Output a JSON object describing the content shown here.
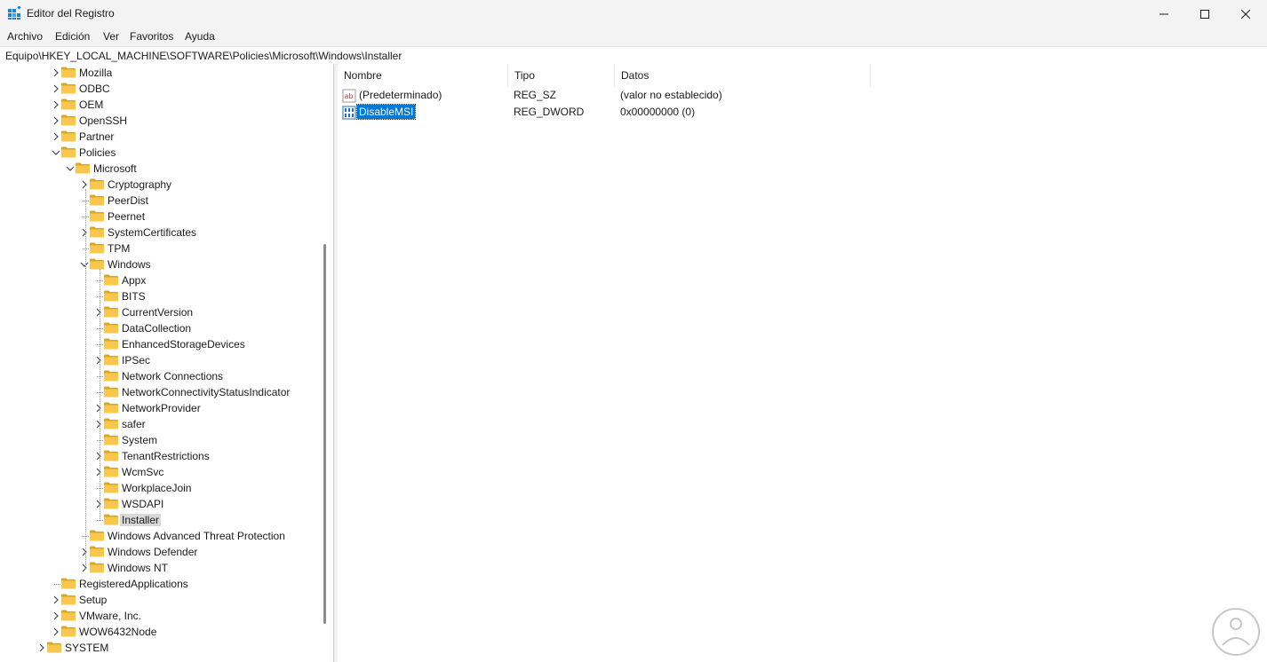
{
  "window": {
    "title": "Editor del Registro"
  },
  "menu": [
    "Archivo",
    "Edición",
    "Ver",
    "Favoritos",
    "Ayuda"
  ],
  "address": "Equipo\\HKEY_LOCAL_MACHINE\\SOFTWARE\\Policies\\Microsoft\\Windows\\Installer",
  "tree": [
    {
      "label": "Mozilla",
      "level": 0,
      "expander": "collapsed"
    },
    {
      "label": "ODBC",
      "level": 0,
      "expander": "collapsed"
    },
    {
      "label": "OEM",
      "level": 0,
      "expander": "collapsed"
    },
    {
      "label": "OpenSSH",
      "level": 0,
      "expander": "collapsed"
    },
    {
      "label": "Partner",
      "level": 0,
      "expander": "collapsed"
    },
    {
      "label": "Policies",
      "level": 0,
      "expander": "expanded"
    },
    {
      "label": "Microsoft",
      "level": 1,
      "expander": "expanded"
    },
    {
      "label": "Cryptography",
      "level": 2,
      "expander": "collapsed"
    },
    {
      "label": "PeerDist",
      "level": 2,
      "expander": "none"
    },
    {
      "label": "Peernet",
      "level": 2,
      "expander": "none"
    },
    {
      "label": "SystemCertificates",
      "level": 2,
      "expander": "collapsed"
    },
    {
      "label": "TPM",
      "level": 2,
      "expander": "none"
    },
    {
      "label": "Windows",
      "level": 2,
      "expander": "expanded"
    },
    {
      "label": "Appx",
      "level": 3,
      "expander": "none"
    },
    {
      "label": "BITS",
      "level": 3,
      "expander": "none"
    },
    {
      "label": "CurrentVersion",
      "level": 3,
      "expander": "collapsed"
    },
    {
      "label": "DataCollection",
      "level": 3,
      "expander": "none"
    },
    {
      "label": "EnhancedStorageDevices",
      "level": 3,
      "expander": "none"
    },
    {
      "label": "IPSec",
      "level": 3,
      "expander": "collapsed"
    },
    {
      "label": "Network Connections",
      "level": 3,
      "expander": "none"
    },
    {
      "label": "NetworkConnectivityStatusIndicator",
      "level": 3,
      "expander": "none"
    },
    {
      "label": "NetworkProvider",
      "level": 3,
      "expander": "collapsed"
    },
    {
      "label": "safer",
      "level": 3,
      "expander": "collapsed"
    },
    {
      "label": "System",
      "level": 3,
      "expander": "none"
    },
    {
      "label": "TenantRestrictions",
      "level": 3,
      "expander": "collapsed"
    },
    {
      "label": "WcmSvc",
      "level": 3,
      "expander": "collapsed"
    },
    {
      "label": "WorkplaceJoin",
      "level": 3,
      "expander": "none"
    },
    {
      "label": "WSDAPI",
      "level": 3,
      "expander": "collapsed"
    },
    {
      "label": "Installer",
      "level": 3,
      "expander": "none",
      "selected": true
    },
    {
      "label": "Windows Advanced Threat Protection",
      "level": 2,
      "expander": "none"
    },
    {
      "label": "Windows Defender",
      "level": 2,
      "expander": "collapsed"
    },
    {
      "label": "Windows NT",
      "level": 2,
      "expander": "collapsed"
    },
    {
      "label": "RegisteredApplications",
      "level": 0,
      "expander": "none"
    },
    {
      "label": "Setup",
      "level": 0,
      "expander": "collapsed"
    },
    {
      "label": "VMware, Inc.",
      "level": 0,
      "expander": "collapsed"
    },
    {
      "label": "WOW6432Node",
      "level": 0,
      "expander": "collapsed"
    },
    {
      "label": "SYSTEM",
      "level": -1,
      "expander": "collapsed"
    }
  ],
  "values_table": {
    "headers": [
      "Nombre",
      "Tipo",
      "Datos"
    ],
    "rows": [
      {
        "name": "(Predeterminado)",
        "type": "REG_SZ",
        "data": "(valor no establecido)",
        "icon": "string-value-icon",
        "selected": false
      },
      {
        "name": "DisableMSI",
        "type": "REG_DWORD",
        "data": "0x00000000 (0)",
        "icon": "binary-value-icon",
        "selected": true
      }
    ]
  },
  "colors": {
    "folder": "#f8c74c",
    "folder_dark": "#e0a422",
    "selection": "#0078d7",
    "tree_selection": "#d9d9d9"
  }
}
